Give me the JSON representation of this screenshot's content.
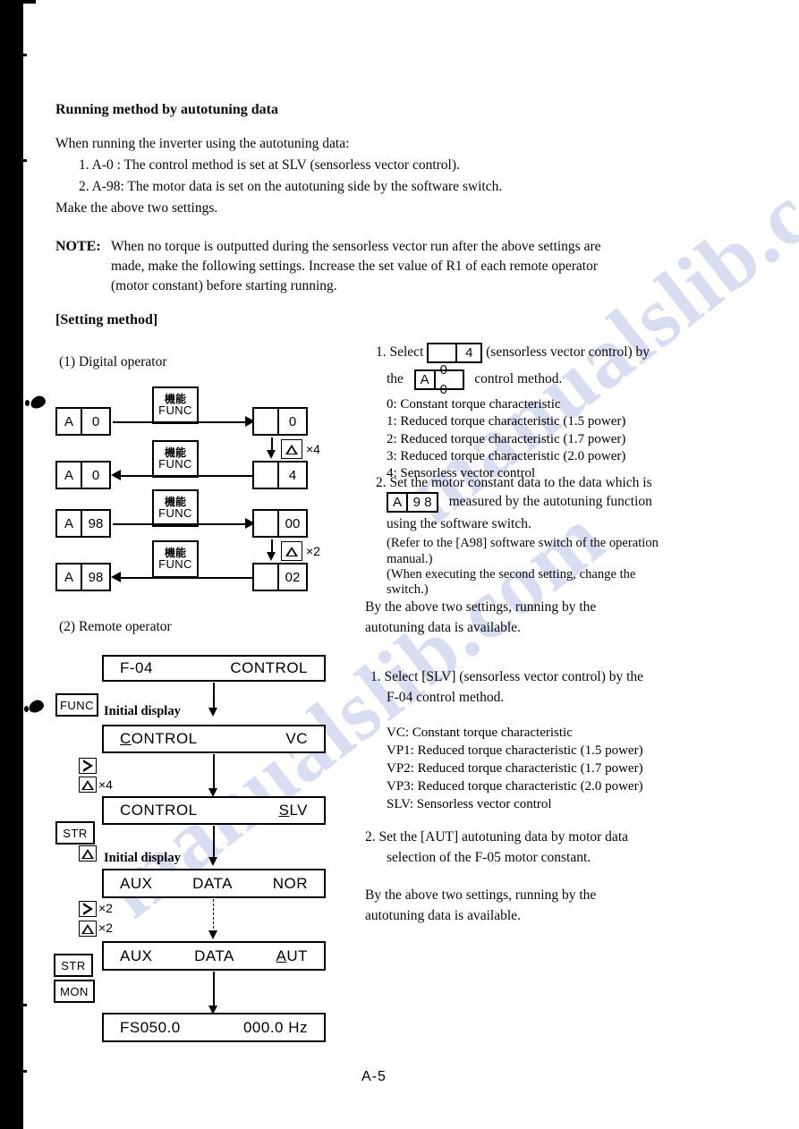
{
  "page": {
    "number": "A-5",
    "watermark": "manualslib.com"
  },
  "intro": {
    "heading": "Running method by autotuning data",
    "lead": "When running the inverter using the autotuning data:",
    "item1": "1.  A-0  : The control method is set at SLV (sensorless vector control).",
    "item2": "2.  A-98: The motor data is set on the autotuning side by the software switch.",
    "closing": "Make the above two settings.",
    "note_label": "NOTE:",
    "note_line1": "When no torque is outputted during the sensorless vector run after the above settings are",
    "note_line2": "made, make the following settings.  Increase the set value of R1 of each remote operator",
    "note_line3": "(motor constant) before starting running."
  },
  "setting_method": {
    "heading": "[Setting method]",
    "section1_label": "(1)  Digital operator",
    "section2_label": "(2)  Remote operator"
  },
  "digital_operator": {
    "func_key": {
      "jp": "機能",
      "en": "FUNC"
    },
    "rows": [
      {
        "left_code": "A",
        "left_value": "0",
        "right_value": "0"
      },
      {
        "left_code": "A",
        "left_value": "0",
        "right_value": "4"
      },
      {
        "left_code": "A",
        "left_value": "98",
        "right_value": "00"
      },
      {
        "left_code": "A",
        "left_value": "98",
        "right_value": "02"
      }
    ],
    "up_key_mult_1": "×4",
    "up_key_mult_2": "×2"
  },
  "remote_operator": {
    "initial_display_label": "Initial display",
    "keys": {
      "func": "FUNC",
      "str": "STR",
      "mon": "MON"
    },
    "mult_x4": "×4",
    "mult_x2_a": "×2",
    "mult_x2_b": "×2",
    "displays": [
      {
        "left": "F-04",
        "center": "",
        "right": "CONTROL"
      },
      {
        "left": "CONTROL",
        "center": "",
        "right": "VC"
      },
      {
        "left": "CONTROL",
        "center": "",
        "right": "SLV"
      },
      {
        "left": "AUX",
        "center": "DATA",
        "right": "NOR"
      },
      {
        "left": "AUX",
        "center": "DATA",
        "right": "AUT"
      },
      {
        "left": "FS050.0",
        "center": "",
        "right": "000.0  Hz"
      }
    ]
  },
  "digital_text": {
    "step1_a": "1.  Select",
    "step1_box_value": "4",
    "step1_b": "(sensorless vector control) by",
    "step1_c": "the",
    "step1_code_a": "A",
    "step1_code_b": "0 0",
    "step1_d": "control method.",
    "options": [
      "0:  Constant torque characteristic",
      "1:  Reduced torque characteristic (1.5 power)",
      "2:  Reduced torque characteristic (1.7 power)",
      "3:  Reduced torque characteristic (2.0 power)",
      "4:  Sensorless vector control"
    ],
    "step2_a": "2.  Set the motor constant data to the data which is",
    "step2_code_a": "A",
    "step2_code_b": "9 8",
    "step2_b": "measured by the autotuning function",
    "step2_c": "using the software switch.",
    "step2_d": "(Refer to the [A98] software switch of the operation",
    "step2_e": "manual.)",
    "step2_f": "(When executing the second setting, change the",
    "step2_g": "switch.)",
    "conclusion_1": "By the above two settings, running by the",
    "conclusion_2": "autotuning data is available."
  },
  "remote_text": {
    "step1_a": "1.  Select [SLV] (sensorless vector control) by the",
    "step1_b": "F-04 control method.",
    "options": [
      "VC:   Constant torque characteristic",
      "VP1:  Reduced torque characteristic (1.5 power)",
      "VP2:  Reduced torque characteristic (1.7 power)",
      "VP3:  Reduced torque characteristic (2.0 power)",
      "SLV:  Sensorless vector control"
    ],
    "step2_a": "2.  Set the [AUT] autotuning data by motor data",
    "step2_b": "selection of the F-05 motor constant.",
    "conclusion_1": "By the above two settings, running by the",
    "conclusion_2": "autotuning data is available."
  }
}
